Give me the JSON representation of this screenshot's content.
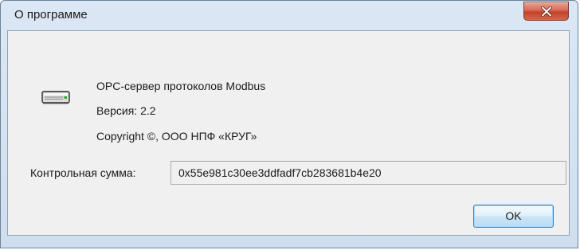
{
  "window": {
    "title": "О программе",
    "close_icon": "close-icon"
  },
  "about": {
    "icon": "device-icon",
    "product_name": "OPC-сервер протоколов Modbus",
    "version": "Версия: 2.2",
    "copyright": "Copyright ©, ООО НПФ «КРУГ»"
  },
  "checksum": {
    "label": "Контрольная сумма:",
    "value": "0x55e981c30ee3ddfadf7cb283681b4e20"
  },
  "buttons": {
    "ok_label": "OK"
  },
  "colors": {
    "client_bg": "#f0f0f0",
    "frame_bg": "#dbe7f4",
    "close_button": "#c2412a",
    "ok_button_border": "#3c7fb1"
  }
}
